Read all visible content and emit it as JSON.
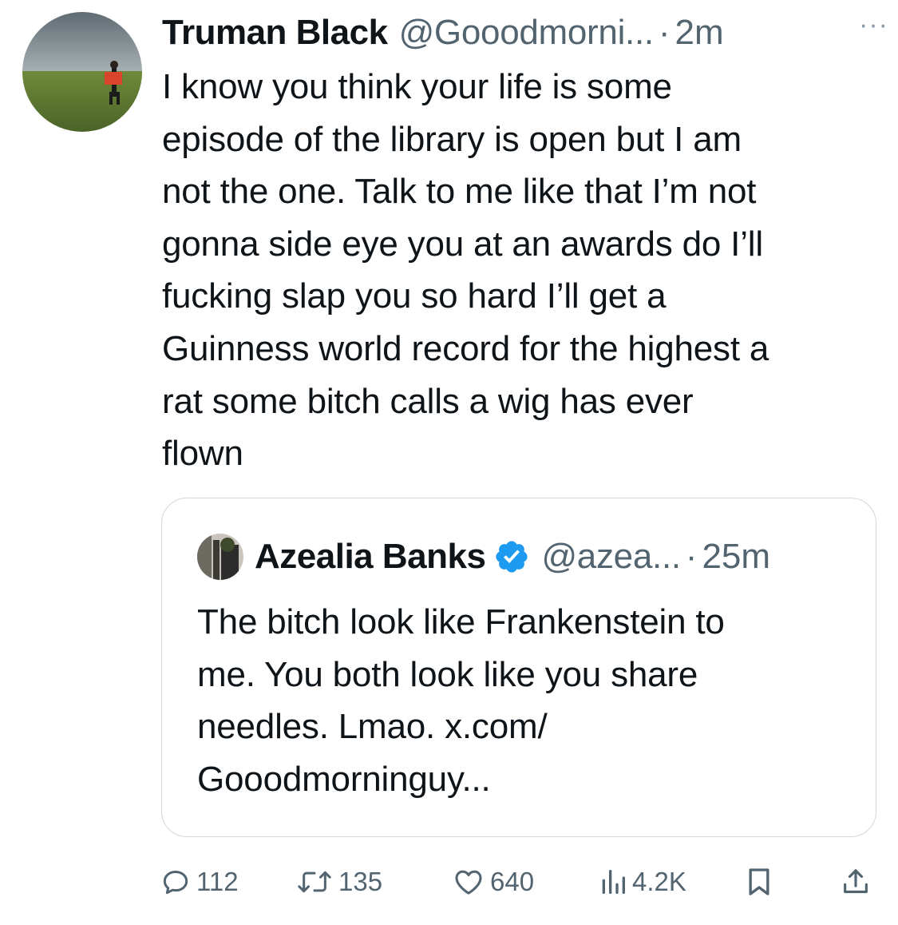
{
  "tweet": {
    "author_name": "Truman Black",
    "author_handle": "@Gooodmorni...",
    "separator": "·",
    "timestamp": "2m",
    "more_menu": "···",
    "lines": [
      "I know you think your life is some",
      "episode of the library is open but I am",
      "not the one. Talk to me like that I’m not",
      "gonna side eye you at an awards do I’ll",
      "fucking slap you so hard I’ll get a",
      "Guinness world record for the highest a",
      "rat some bitch calls a wig has ever",
      "flown"
    ]
  },
  "quote": {
    "author_name": "Azealia Banks",
    "verified": true,
    "author_handle": "@azea...",
    "separator": "·",
    "timestamp": "25m",
    "lines": [
      "The bitch look like Frankenstein to",
      "me. You both look like you share",
      "needles. Lmao. x.com/",
      "Gooodmorninguy..."
    ]
  },
  "actions": {
    "replies": "112",
    "reposts": "135",
    "likes": "640",
    "views": "4.2K"
  },
  "icons": {
    "reply": "reply-icon",
    "repost": "repost-icon",
    "like": "heart-icon",
    "views": "views-chart-icon",
    "bookmark": "bookmark-icon",
    "share": "share-icon",
    "verified": "verified-badge-icon"
  },
  "colors": {
    "text": "#0f1419",
    "secondary": "#536471",
    "border": "#cfd9de",
    "verified": "#1d9bf0"
  }
}
